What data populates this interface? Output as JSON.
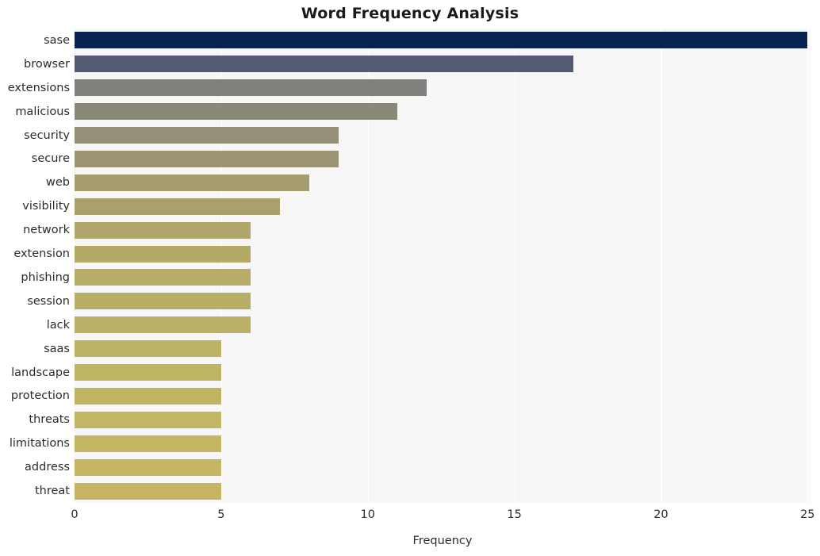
{
  "chart_data": {
    "type": "bar",
    "orientation": "horizontal",
    "title": "Word Frequency Analysis",
    "xlabel": "Frequency",
    "ylabel": "",
    "categories": [
      "sase",
      "browser",
      "extensions",
      "malicious",
      "security",
      "secure",
      "web",
      "visibility",
      "network",
      "extension",
      "phishing",
      "session",
      "lack",
      "saas",
      "landscape",
      "protection",
      "threats",
      "limitations",
      "address",
      "threat"
    ],
    "values": [
      25,
      17,
      12,
      11,
      9,
      9,
      8,
      7,
      6,
      6,
      6,
      6,
      6,
      5,
      5,
      5,
      5,
      5,
      5,
      5
    ],
    "bar_colors": [
      "#06244f",
      "#545a72",
      "#7f7f7c",
      "#8a8879",
      "#999madeup",
      "#9b9475",
      "#a59c70",
      "#aaa06c",
      "#b0a76a",
      "#b4aa68",
      "#b7ad67",
      "#b9ae66",
      "#bbb065",
      "#bdb264",
      "#bfb364",
      "#c0b463",
      "#c2b563",
      "#c3b663",
      "#c4b663",
      "#c5b563"
    ],
    "xticks": [
      0,
      5,
      10,
      15,
      20,
      25
    ],
    "xlim": [
      0,
      25.1
    ],
    "grid": true,
    "grid_axis": "x",
    "grid_color": "#ffffff",
    "plot_background": "#f7f7f7",
    "figure_background": "#ffffff",
    "legend": null
  },
  "colors": {
    "title_text": "#1a1a1a",
    "tick_text": "#2b2b2b",
    "accent_dark": "#06244f",
    "accent_light": "#c5b563"
  }
}
